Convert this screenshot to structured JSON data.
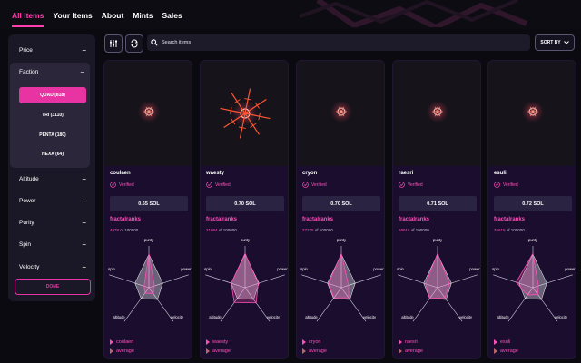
{
  "nav": {
    "tabs": [
      "All Items",
      "Your Items",
      "About",
      "Mints",
      "Sales"
    ],
    "active_index": 0
  },
  "sidebar": {
    "facets_top": [
      {
        "label": "Price",
        "sign": "+"
      }
    ],
    "faction": {
      "label": "Faction",
      "sign": "−",
      "options": [
        "QUAD (818)",
        "TRI (3110)",
        "PENTA (180)",
        "HEXA (64)"
      ],
      "selected_index": 0
    },
    "facets_bottom": [
      {
        "label": "Altitude",
        "sign": "+"
      },
      {
        "label": "Power",
        "sign": "+"
      },
      {
        "label": "Purity",
        "sign": "+"
      },
      {
        "label": "Spin",
        "sign": "+"
      },
      {
        "label": "Velocity",
        "sign": "+"
      }
    ],
    "done_label": "DONE"
  },
  "toolbar": {
    "filter_icon": "filter-sliders-icon",
    "refresh_icon": "refresh-icon",
    "search_placeholder": "Search items",
    "sort_label": "SORT BY",
    "sort_icon": "chevron-down-icon"
  },
  "colors": {
    "accent": "#e834a3",
    "accent_text": "#ff4fb8",
    "card_bg": "#1a0d2e",
    "sidebar_bg": "#1a1726"
  },
  "radar_axes": [
    "purity",
    "power",
    "velocity",
    "altitude",
    "spin"
  ],
  "cards": [
    {
      "name": "coulaen",
      "verified": "Verified",
      "price": "0.65 SOL",
      "fr_label": "fractalranks",
      "rank_no": "4978",
      "rank_total": "of 100000",
      "legend_name": "coulaen",
      "legend_avg": "average",
      "art": "small",
      "stats": [
        0.82,
        0.14,
        0.18,
        0.16,
        0.12
      ],
      "avg": [
        0.8,
        0.35,
        0.35,
        0.32,
        0.35
      ]
    },
    {
      "name": "waesty",
      "verified": "Verified",
      "price": "0.70 SOL",
      "fr_label": "fractalranks",
      "rank_no": "21094",
      "rank_total": "of 100000",
      "legend_name": "waesty",
      "legend_avg": "average",
      "art": "burst",
      "stats": [
        0.82,
        0.33,
        0.45,
        0.44,
        0.35
      ],
      "avg": [
        0.8,
        0.35,
        0.35,
        0.32,
        0.35
      ]
    },
    {
      "name": "cryon",
      "verified": "Verified",
      "price": "0.70 SOL",
      "fr_label": "fractalranks",
      "rank_no": "27275",
      "rank_total": "of 100000",
      "legend_name": "cryon",
      "legend_avg": "average",
      "art": "small",
      "stats": [
        0.82,
        0.18,
        0.3,
        0.3,
        0.32
      ],
      "avg": [
        0.8,
        0.35,
        0.35,
        0.32,
        0.35
      ]
    },
    {
      "name": "raesri",
      "verified": "Verified",
      "price": "0.71 SOL",
      "fr_label": "fractalranks",
      "rank_no": "59916",
      "rank_total": "of 100000",
      "legend_name": "raesri",
      "legend_avg": "average",
      "art": "small",
      "stats": [
        0.82,
        0.3,
        0.3,
        0.32,
        0.3
      ],
      "avg": [
        0.8,
        0.35,
        0.35,
        0.32,
        0.35
      ]
    },
    {
      "name": "esuli",
      "verified": "Verified",
      "price": "0.72 SOL",
      "fr_label": "fractalranks",
      "rank_no": "36615",
      "rank_total": "of 100000",
      "legend_name": "esuli",
      "legend_avg": "average",
      "art": "small",
      "stats": [
        0.82,
        0.14,
        0.2,
        0.22,
        0.42
      ],
      "avg": [
        0.8,
        0.35,
        0.35,
        0.32,
        0.35
      ]
    }
  ]
}
